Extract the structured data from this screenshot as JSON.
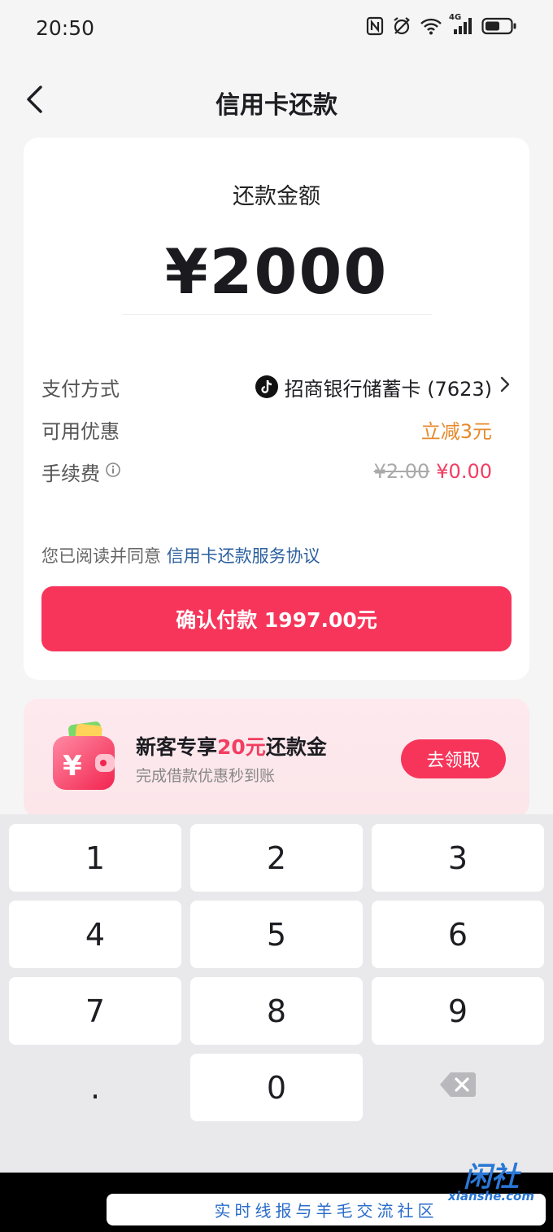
{
  "status_bar": {
    "time": "20:50",
    "icons": [
      "nfc-icon",
      "alarm-icon",
      "wifi-icon",
      "signal-4g-icon",
      "battery-icon"
    ],
    "network_label": "4G"
  },
  "nav": {
    "title": "信用卡还款",
    "back_icon": "chevron-left-icon"
  },
  "payment": {
    "amount_label": "还款金额",
    "amount_value": "¥2000",
    "rows": {
      "method_label": "支付方式",
      "method_value": "招商银行储蓄卡 (7623)",
      "promo_label": "可用优惠",
      "promo_value": "立减3元",
      "fee_label": "手续费",
      "fee_old": "¥2.00",
      "fee_new": "¥0.00"
    },
    "agree_prefix": "您已阅读并同意 ",
    "agree_link": "信用卡还款服务协议",
    "confirm_button": "确认付款 1997.00元"
  },
  "promo_banner": {
    "title_prefix": "新客专享",
    "title_highlight": "20元",
    "title_suffix": "还款金",
    "subtitle": "完成借款优惠秒到账",
    "claim_button": "去领取",
    "wallet_symbol": "¥"
  },
  "keypad": {
    "keys": [
      "1",
      "2",
      "3",
      "4",
      "5",
      "6",
      "7",
      "8",
      "9",
      ".",
      "0"
    ],
    "delete_icon": "backspace-icon"
  },
  "watermark": {
    "banner_text": "实时线报与羊毛交流社区",
    "logo_text": "闲社",
    "logo_sub": "xianshe.com"
  },
  "colors": {
    "accent": "#f7355a",
    "promo_orange": "#e68a2e",
    "link_blue": "#2b5f9e",
    "background": "#f5f5f6"
  }
}
